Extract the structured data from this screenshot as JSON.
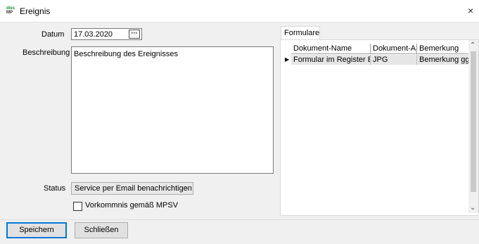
{
  "window": {
    "title": "Ereignis",
    "icon_top": "dies",
    "icon_bottom": "MP",
    "close_glyph": "×"
  },
  "form": {
    "date_label": "Datum",
    "date_value": "17.03.2020",
    "date_button": "···",
    "description_label": "Beschreibung",
    "description_value": "Beschreibung des Ereignisses",
    "status_label": "Status",
    "status_value": "Service per Email benachrichtigen",
    "checkbox_label": "Vorkommnis gemäß MPSV",
    "checkbox_checked": false
  },
  "forms_tab": {
    "tab_label": "Formulare",
    "columns": [
      "Dokument-Name",
      "Dokument-Art",
      "Bemerkung"
    ],
    "rows": [
      [
        "Formular im Register Erei",
        "JPG",
        "Bemerkung ggf. v"
      ]
    ],
    "row_indicator": "▶"
  },
  "buttons": {
    "save": "Speichern",
    "close": "Schließen"
  }
}
